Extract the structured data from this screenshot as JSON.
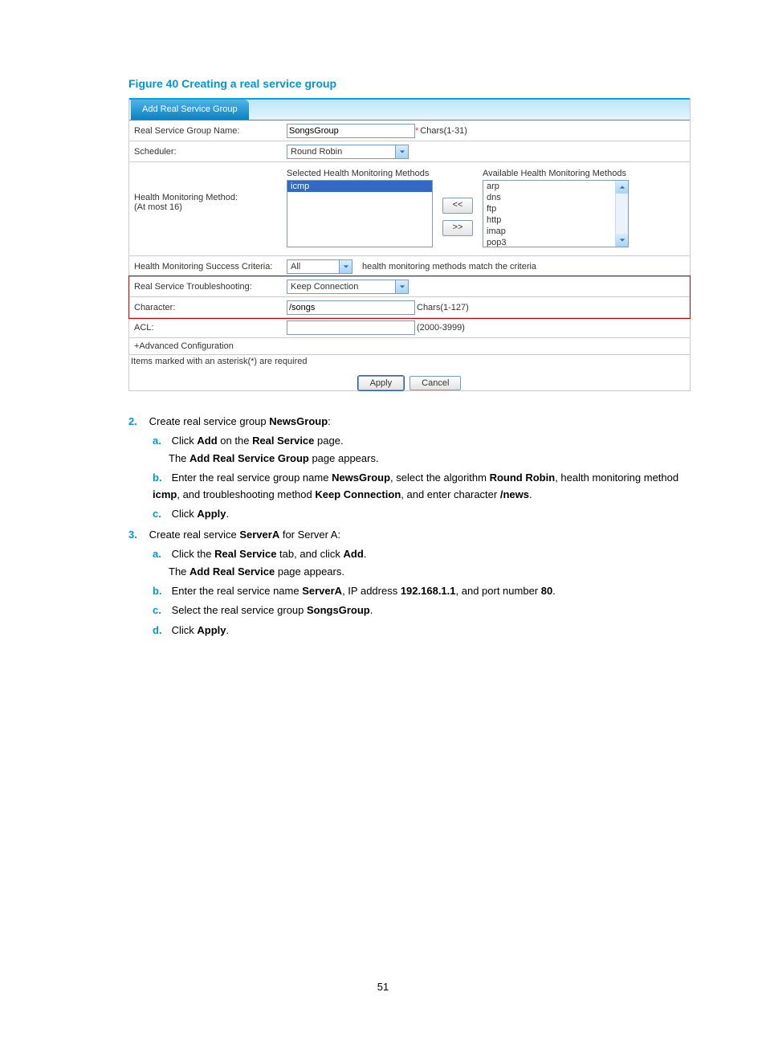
{
  "figureTitle": "Figure 40 Creating a real service group",
  "tabLabel": "Add Real Service Group",
  "form": {
    "groupNameLabel": "Real Service Group Name:",
    "groupNameValue": "SongsGroup",
    "groupNameHint": "Chars(1-31)",
    "schedulerLabel": "Scheduler:",
    "schedulerValue": "Round Robin",
    "hmmLabel1": "Health Monitoring Method:",
    "hmmLabel2": "(At most 16)",
    "selectedHmmHeader": "Selected Health Monitoring Methods",
    "availableHmmHeader": "Available Health Monitoring Methods",
    "selectedMethods": [
      "icmp"
    ],
    "availableMethods": [
      "arp",
      "dns",
      "ftp",
      "http",
      "imap",
      "pop3"
    ],
    "moveLeft": "<<",
    "moveRight": ">>",
    "criteriaLabel": "Health Monitoring Success Criteria:",
    "criteriaValue": "All",
    "criteriaSuffix": "health monitoring methods match the criteria",
    "troubleshootLabel": "Real Service Troubleshooting:",
    "troubleshootValue": "Keep Connection",
    "characterLabel": "Character:",
    "characterValue": "/songs",
    "characterHint": "Chars(1-127)",
    "aclLabel": "ACL:",
    "aclHint": "(2000-3999)",
    "advLabel": "+Advanced Configuration",
    "footNote": "Items marked with an asterisk(*) are required",
    "applyBtn": "Apply",
    "cancelBtn": "Cancel",
    "asterisk": "*"
  },
  "steps": {
    "s2_text1": "Create real service group ",
    "s2_bold": "NewsGroup",
    "s2_colon": ":",
    "s2a_t1": "Click ",
    "s2a_b1": "Add",
    "s2a_t2": " on the ",
    "s2a_b2": "Real Service",
    "s2a_t3": " page.",
    "s2a_sub_t1": "The ",
    "s2a_sub_b1": "Add Real Service Group",
    "s2a_sub_t2": " page appears.",
    "s2b_t1": "Enter the real service group name ",
    "s2b_b1": "NewsGroup",
    "s2b_t2": ", select the algorithm ",
    "s2b_b2": "Round Robin",
    "s2b_t3": ", health monitoring method ",
    "s2b_b3": "icmp",
    "s2b_t4": ", and troubleshooting method ",
    "s2b_b4": "Keep Connection",
    "s2b_t5": ", and enter character ",
    "s2b_b5": "/news",
    "s2b_t6": ".",
    "s2c_t1": "Click ",
    "s2c_b1": "Apply",
    "s2c_t2": ".",
    "s3_t1": "Create real service ",
    "s3_b1": "ServerA",
    "s3_t2": " for Server A:",
    "s3a_t1": "Click the ",
    "s3a_b1": "Real Service",
    "s3a_t2": " tab, and click ",
    "s3a_b2": "Add",
    "s3a_t3": ".",
    "s3a_sub_t1": "The ",
    "s3a_sub_b1": "Add Real Service",
    "s3a_sub_t2": " page appears.",
    "s3b_t1": "Enter the real service name ",
    "s3b_b1": "ServerA",
    "s3b_t2": ", IP address ",
    "s3b_b2": "192.168.1.1",
    "s3b_t3": ", and port number ",
    "s3b_b3": "80",
    "s3b_t4": ".",
    "s3c_t1": "Select the real service group ",
    "s3c_b1": "SongsGroup",
    "s3c_t2": ".",
    "s3d_t1": "Click ",
    "s3d_b1": "Apply",
    "s3d_t2": ".",
    "m2": "2.",
    "m3": "3.",
    "ma": "a.",
    "mb": "b.",
    "mc": "c.",
    "md": "d."
  },
  "pageNumber": "51"
}
